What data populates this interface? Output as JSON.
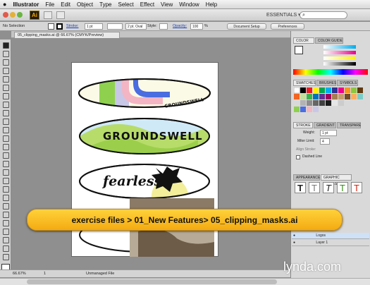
{
  "menubar": {
    "apple": "",
    "items": [
      "Illustrator",
      "File",
      "Edit",
      "Object",
      "Type",
      "Select",
      "Effect",
      "View",
      "Window",
      "Help"
    ]
  },
  "appbar": {
    "logo": "Ai",
    "workspace": "ESSENTIALS ▾"
  },
  "control": {
    "selection": "No Selection",
    "stroke_label": "Stroke:",
    "stroke_value": "1 pt",
    "brush_value": "2 pt. Oval",
    "style_label": "Style:",
    "opacity_label": "Opacity:",
    "opacity_value": "100",
    "opacity_unit": "%",
    "doc_setup": "Document Setup",
    "preferences": "Preferences"
  },
  "document": {
    "tab": "05_clipping_masks.ai @ 66.67% (CMYK/Preview)"
  },
  "artwork": {
    "board1_text": "GROUNDSWELL",
    "board2_text": "GROUNDSWELL",
    "board3_text": "fearless"
  },
  "status": {
    "zoom": "66.67%",
    "page": "1",
    "file_state": "Unmanaged File"
  },
  "panels": {
    "color_tabs": [
      "COLOR",
      "COLOR GUIDE"
    ],
    "swatch_tabs": [
      "SWATCHES",
      "BRUSHES",
      "SYMBOLS"
    ],
    "stroke_tabs": [
      "STROKE",
      "GRADIENT",
      "TRANSPARE"
    ],
    "weight_label": "Weight:",
    "weight_value": "1 pt",
    "miter_label": "Miter Limit:",
    "miter_value": "4",
    "align_label": "Align Stroke:",
    "dashed_label": "Dashed Line",
    "appearance_tabs": [
      "APPEARANCE",
      "GRAPHIC STYLES"
    ],
    "layers": [
      {
        "name": "Logos"
      },
      {
        "name": "Layer 1"
      }
    ]
  },
  "banner": {
    "text": "exercise files > 01_New Features> 05_clipping_masks.ai"
  },
  "watermark": "lynda.com",
  "colors": {
    "banner": "#f7b81e",
    "accent_green": "#8fd14f",
    "accent_blue": "#4a6de0"
  }
}
